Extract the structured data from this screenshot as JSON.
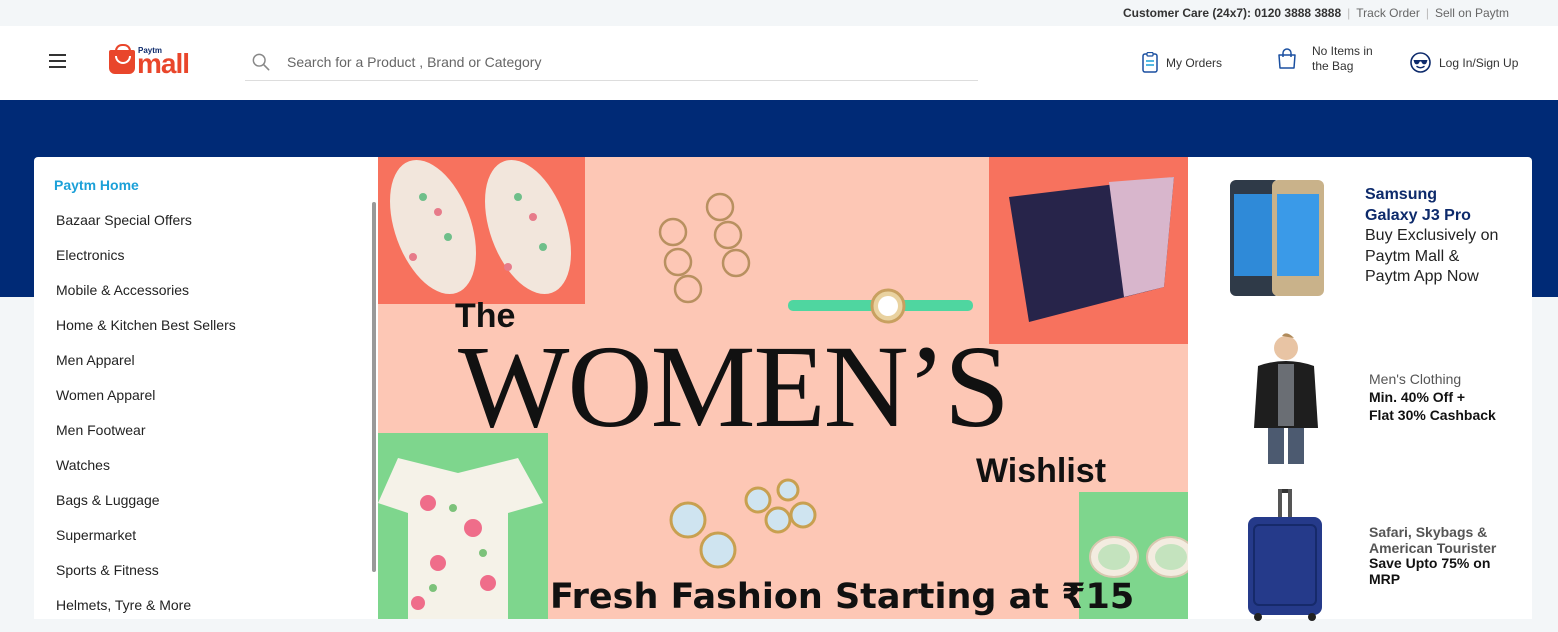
{
  "topbar": {
    "customer_care": "Customer Care (24x7): 0120 3888 3888",
    "track_order": "Track Order",
    "sell_on_paytm": "Sell on Paytm",
    "separator": "|"
  },
  "header": {
    "logo_small": "Paytm",
    "logo_main": "mall",
    "search_placeholder": "Search for a Product , Brand or Category",
    "my_orders": "My Orders",
    "bag_line1": "No Items in",
    "bag_line2": "the Bag",
    "login": "Log In/Sign Up"
  },
  "sidebar": {
    "items": [
      {
        "label": "Paytm Home"
      },
      {
        "label": "Bazaar Special Offers"
      },
      {
        "label": "Electronics"
      },
      {
        "label": "Mobile & Accessories"
      },
      {
        "label": "Home & Kitchen Best Sellers"
      },
      {
        "label": "Men Apparel"
      },
      {
        "label": "Women Apparel"
      },
      {
        "label": "Men Footwear"
      },
      {
        "label": "Watches"
      },
      {
        "label": "Bags & Luggage"
      },
      {
        "label": "Supermarket"
      },
      {
        "label": "Sports & Fitness"
      },
      {
        "label": "Helmets, Tyre & More"
      }
    ]
  },
  "banner": {
    "the": "The",
    "womens": "WOMEN’S",
    "wishlist": "Wishlist",
    "tagline": "Fresh Fashion Starting at ₹15",
    "bg_color": "#fdc7b5"
  },
  "promos": {
    "p1": {
      "title_line1": "Samsung",
      "title_line2": "Galaxy J3 Pro",
      "body_line1": "Buy Exclusively on",
      "body_line2": "Paytm Mall &",
      "body_line3": "Paytm App Now"
    },
    "p2": {
      "line1": "Men's Clothing",
      "line2": "Min. 40% Off +",
      "line3": "Flat 30% Cashback"
    },
    "p3": {
      "line1": "Safari, Skybags &",
      "line2": "American Tourister",
      "line3": "Save Upto 75% on",
      "line4": "MRP"
    }
  },
  "colors": {
    "brand_red": "#e9462b",
    "brand_navy": "#002a76",
    "active_link": "#1ba0d8"
  }
}
